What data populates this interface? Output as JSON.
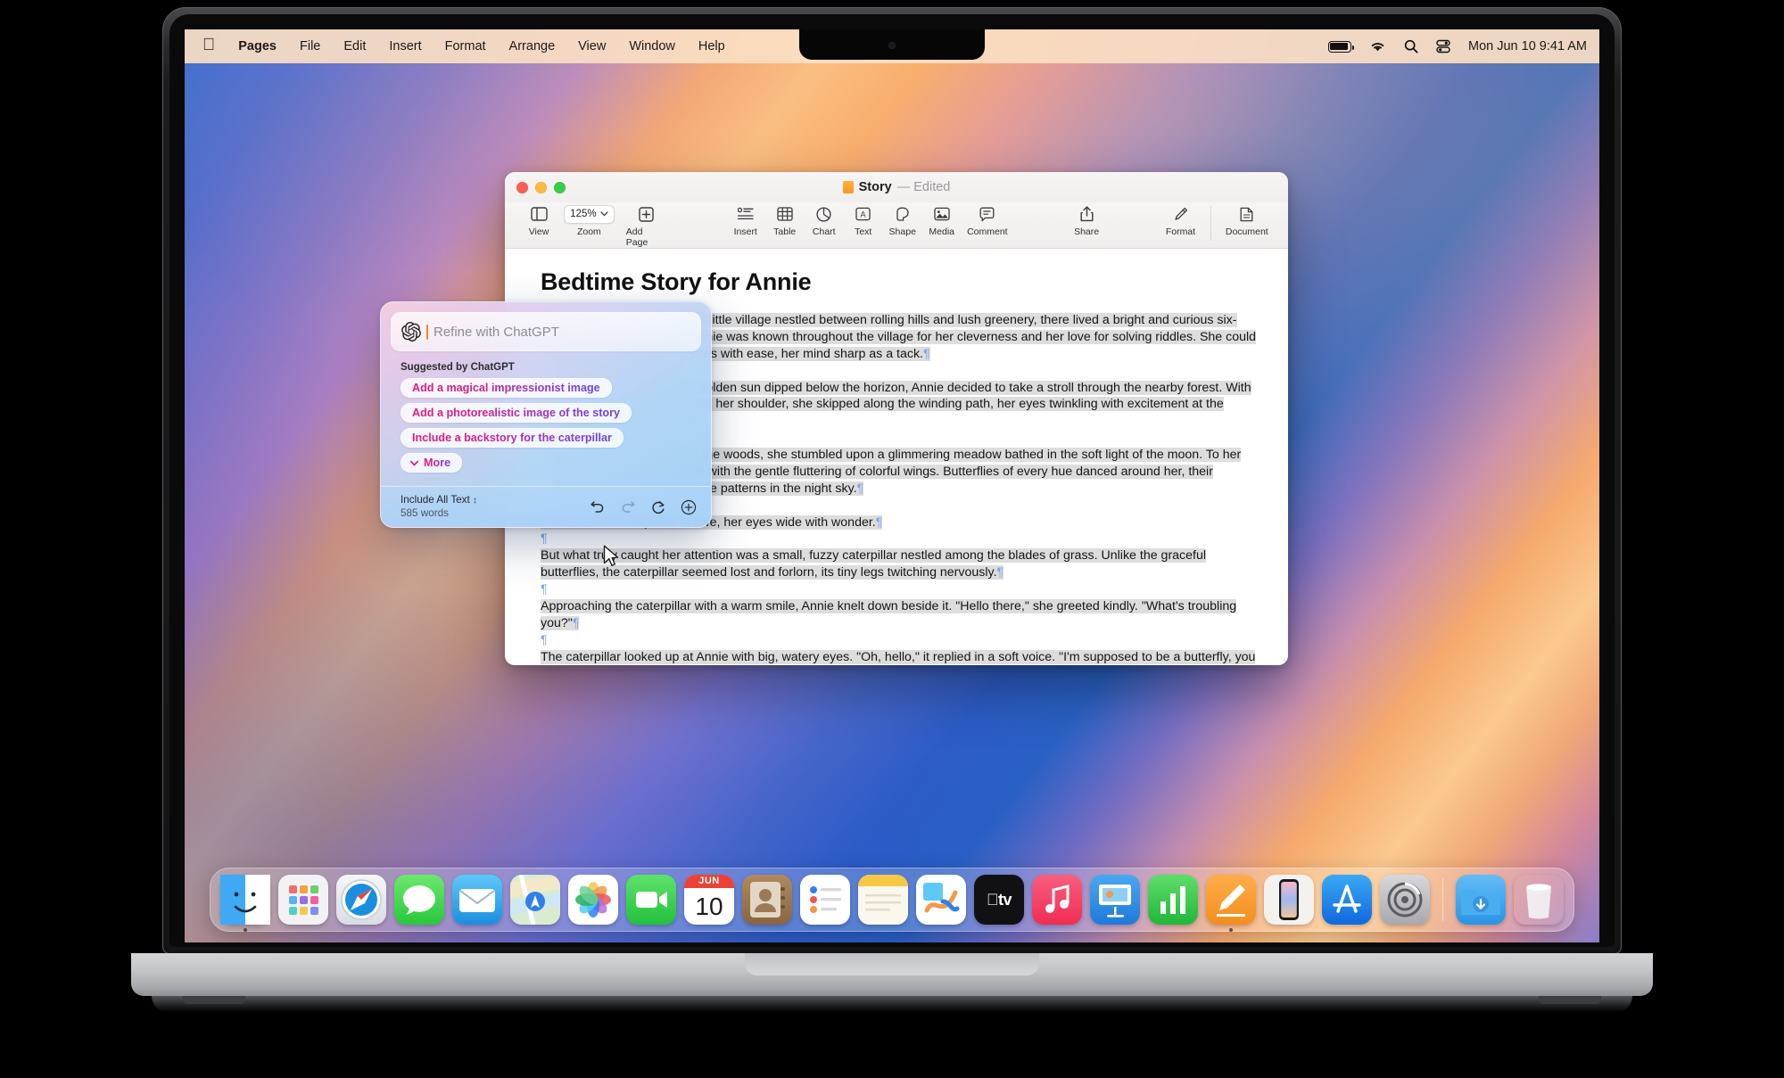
{
  "menubar": {
    "apple_icon": "apple-logo-icon",
    "items": [
      "Pages",
      "File",
      "Edit",
      "Insert",
      "Format",
      "Arrange",
      "View",
      "Window",
      "Help"
    ],
    "status_icons": [
      "battery-icon",
      "wifi-icon",
      "search-icon",
      "control-center-icon"
    ],
    "datetime": "Mon Jun 10  9:41 AM"
  },
  "pages_window": {
    "title": "Story",
    "edited_label": "— Edited",
    "traffic_lights": [
      "close-button",
      "minimize-button",
      "maximize-button"
    ],
    "toolbar": {
      "view": "View",
      "zoom_label": "Zoom",
      "zoom_value": "125%",
      "add_page": "Add Page",
      "insert": "Insert",
      "table": "Table",
      "chart": "Chart",
      "text": "Text",
      "shape": "Shape",
      "media": "Media",
      "comment": "Comment",
      "share": "Share",
      "format": "Format",
      "document": "Document"
    },
    "document": {
      "title": "Bedtime Story for Annie",
      "paragraphs": [
        "Once upon a time, in a quaint little village nestled between rolling hills and lush greenery, there lived a bright and curious six-year-old girl named Annie. Annie was known throughout the village for her cleverness and her love for solving riddles. She could untangle the trickiest of puzzles with ease, her mind sharp as a tack.",
        "One breezy evening, as the golden sun dipped below the horizon, Annie decided to take a stroll through the nearby forest. With her trusty backpack slung over her shoulder, she skipped along the winding path, her eyes twinkling with excitement at the adventures that awaited her.",
        "As she ventured deeper into the woods, she stumbled upon a glimmering meadow bathed in the soft light of the moon. To her amazement, the air was filled with the gentle fluttering of colorful wings. Butterflies of every hue danced around her, their delicate forms weaving intricate patterns in the night sky.",
        "\"Wow,\" Annie whispered in awe, her eyes wide with wonder.",
        "But what truly caught her attention was a small, fuzzy caterpillar nestled among the blades of grass. Unlike the graceful butterflies, the caterpillar seemed lost and forlorn, its tiny legs twitching nervously.",
        "Approaching the caterpillar with a warm smile, Annie knelt down beside it. \"Hello there,\" she greeted kindly. \"What's troubling you?\"",
        "The caterpillar looked up at Annie with big, watery eyes. \"Oh, hello,\" it replied in a soft voice. \"I'm supposed to be a butterfly, you see. But I can't seem to figure out how to break free from my cocoon.\""
      ]
    }
  },
  "chatgpt_panel": {
    "input_placeholder": "Refine with ChatGPT",
    "logo_icon": "openai-logo-icon",
    "suggested_label": "Suggested by ChatGPT",
    "suggestions": [
      "Add a magical impressionist image",
      "Add a photorealistic image of the story",
      "Include a backstory for the caterpillar"
    ],
    "more_label": "More",
    "include_label": "Include All Text",
    "word_count": "585 words",
    "actions": [
      "undo-icon",
      "redo-icon",
      "regenerate-icon",
      "add-icon"
    ],
    "gradient_start": "#e6197e",
    "gradient_end": "#6a45e0"
  },
  "dock": {
    "items": [
      "finder-icon",
      "launchpad-icon",
      "safari-icon",
      "messages-icon",
      "mail-icon",
      "maps-icon",
      "photos-icon",
      "facetime-icon",
      "calendar-icon",
      "contacts-icon",
      "reminders-icon",
      "notes-icon",
      "freeform-icon",
      "appletv-icon",
      "music-icon",
      "keynote-icon",
      "numbers-icon",
      "pages-icon",
      "iphone-mirroring-icon",
      "app-store-icon",
      "system-settings-icon"
    ],
    "calendar_month": "JUN",
    "calendar_day": "10",
    "appletv_label": "tv",
    "trailing_items": [
      "downloads-folder-icon",
      "trash-icon"
    ]
  }
}
